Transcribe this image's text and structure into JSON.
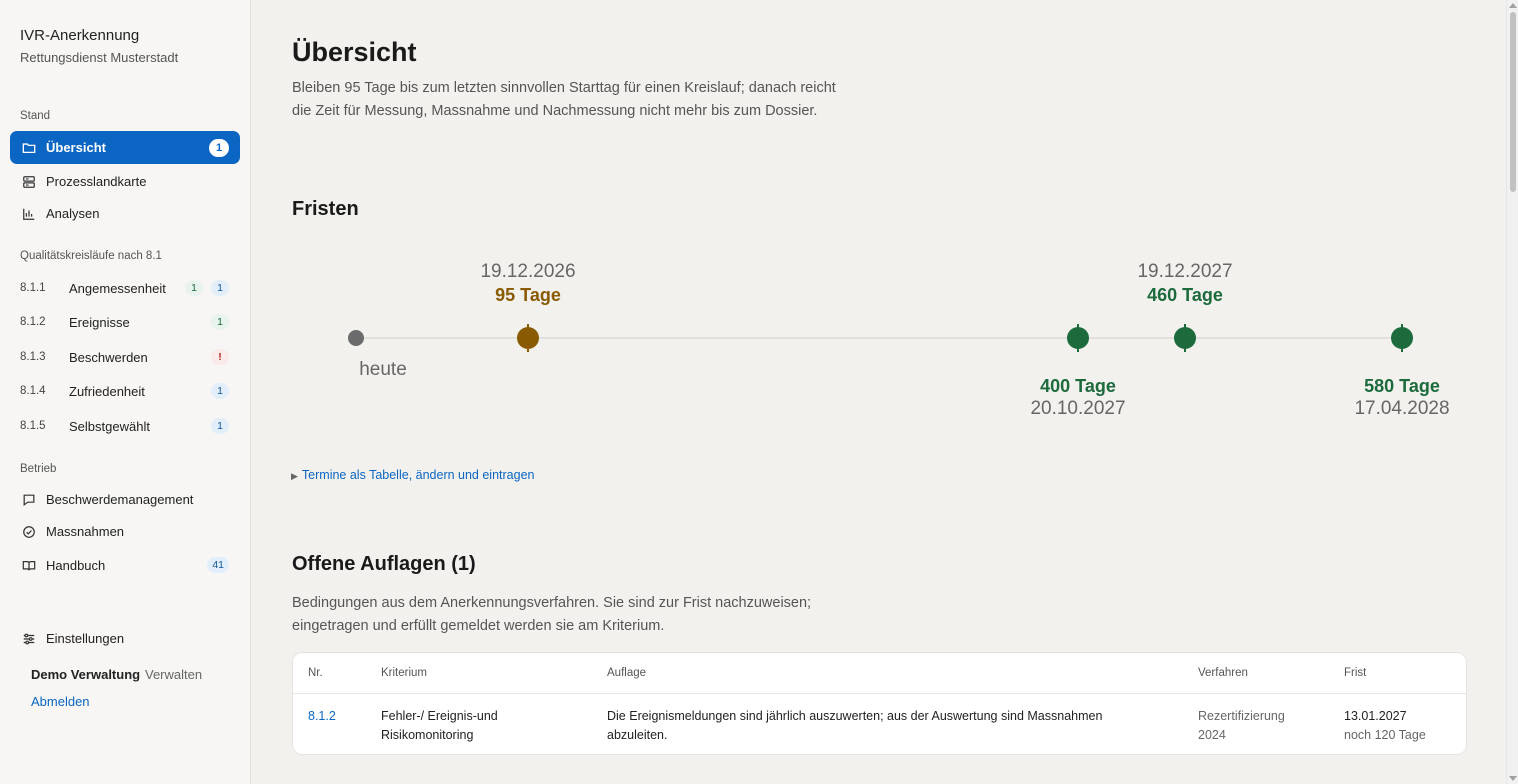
{
  "brand": {
    "title": "IVR-Anerkennung",
    "subtitle": "Rettungsdienst Musterstadt"
  },
  "sidebar": {
    "section_stand": "Stand",
    "stand_items": [
      {
        "label": "Übersicht",
        "icon": "folder-icon",
        "badge": "1",
        "active": true
      },
      {
        "label": "Prozesslandkarte",
        "icon": "server-icon"
      },
      {
        "label": "Analysen",
        "icon": "bar-chart-icon"
      }
    ],
    "section_qk": "Qualitätskreisläufe nach 8.1",
    "qk_items": [
      {
        "num": "8.1.1",
        "label": "Angemessenheit",
        "green": "1",
        "blue": "1"
      },
      {
        "num": "8.1.2",
        "label": "Ereignisse",
        "green": "1"
      },
      {
        "num": "8.1.3",
        "label": "Beschwerden",
        "red": "!"
      },
      {
        "num": "8.1.4",
        "label": "Zufriedenheit",
        "blue": "1"
      },
      {
        "num": "8.1.5",
        "label": "Selbstgewählt",
        "blue": "1"
      }
    ],
    "section_betrieb": "Betrieb",
    "betrieb_items": [
      {
        "label": "Beschwerdemanagement",
        "icon": "message-icon"
      },
      {
        "label": "Massnahmen",
        "icon": "check-circle-icon"
      },
      {
        "label": "Handbuch",
        "icon": "book-icon",
        "badge": "41"
      }
    ],
    "settings": {
      "label": "Einstellungen",
      "icon": "sliders-icon"
    },
    "user": {
      "name": "Demo Verwaltung",
      "manage": "Verwalten",
      "logout": "Abmelden"
    }
  },
  "main": {
    "title": "Übersicht",
    "intro": "Bleiben 95 Tage bis zum letzten sinnvollen Starttag für einen Kreislauf; danach reicht die Zeit für Messung, Massnahme und Nachmessung nicht mehr bis zum Dossier.",
    "fristen_heading": "Fristen",
    "timeline": {
      "today_label": "heute",
      "milestones": [
        {
          "date": "19.12.2026",
          "days": "95 Tage",
          "label_pos": "above",
          "color": "#8a5a00"
        },
        {
          "date": "20.10.2027",
          "days": "400 Tage",
          "label_pos": "below",
          "color": "#1d6b3d"
        },
        {
          "date": "19.12.2027",
          "days": "460 Tage",
          "label_pos": "above",
          "color": "#1d6b3d"
        },
        {
          "date": "17.04.2028",
          "days": "580 Tage",
          "label_pos": "below",
          "color": "#1d6b3d"
        }
      ],
      "today_color": "#6b6b6b",
      "line_color": "#dddad6"
    },
    "details_link": "Termine als Tabelle, ändern und eintragen",
    "auflagen_heading": "Offene Auflagen (1)",
    "auflagen_desc": "Bedingungen aus dem Anerkennungsverfahren. Sie sind zur Frist nachzuweisen; eingetragen und erfüllt gemeldet werden sie am Kriterium.",
    "table": {
      "headers": {
        "nr": "Nr.",
        "kriterium": "Kriterium",
        "auflage": "Auflage",
        "verfahren": "Verfahren",
        "frist": "Frist"
      },
      "rows": [
        {
          "nr": "8.1.2",
          "kriterium_1": "Fehler-/ Ereignis-und",
          "kriterium_2": "Risikomonitoring",
          "auflage_1": "Die Ereignismeldungen sind jährlich auszuwerten; aus der Auswertung sind Massnahmen",
          "auflage_2": "abzuleiten.",
          "verfahren_1": "Rezertifizierung",
          "verfahren_2": "2024",
          "frist_1": "13.01.2027",
          "frist_2": "noch 120 Tage"
        }
      ]
    }
  },
  "colors": {
    "accent": "#0b66c3",
    "warning": "#8a5a00",
    "ok": "#1d6b3d"
  }
}
